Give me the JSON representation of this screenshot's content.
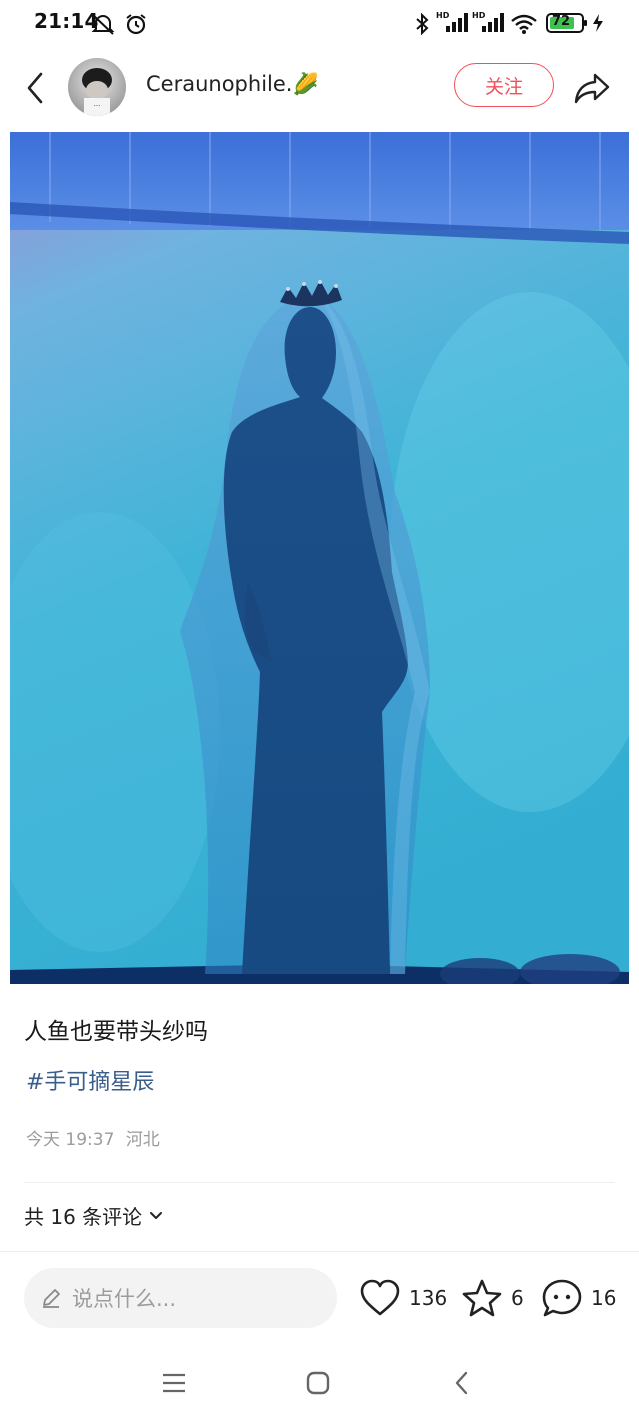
{
  "status_bar": {
    "time": "21:14",
    "battery": "72",
    "icons": [
      "notification-muted-icon",
      "alarm-icon",
      "bluetooth-icon",
      "hd-signal-icon",
      "hd-signal-icon",
      "wifi-icon",
      "battery-icon",
      "charging-icon"
    ],
    "signal_badge_1": "HD",
    "signal_badge_2": "HD"
  },
  "header": {
    "username": "Ceraunophile.🌽",
    "follow_label": "关注",
    "icons": [
      "back-arrow-icon",
      "share-icon"
    ]
  },
  "post": {
    "text": "人鱼也要带头纱吗",
    "tag": "#手可摘星辰",
    "time": "今天 19:37",
    "location": "河北"
  },
  "comments": {
    "summary": "共 16 条评论",
    "icon": "chevron-down-icon"
  },
  "action_bar": {
    "input_placeholder": "说点什么...",
    "likes": "136",
    "favorites": "6",
    "comments": "16"
  },
  "nav_bar": {
    "icons": [
      "menu-icon",
      "home-icon",
      "back-icon"
    ]
  },
  "colors": {
    "accent": "#f2505a",
    "tag": "#3a5e8c",
    "photo_cyan": "#3fb4d6"
  }
}
